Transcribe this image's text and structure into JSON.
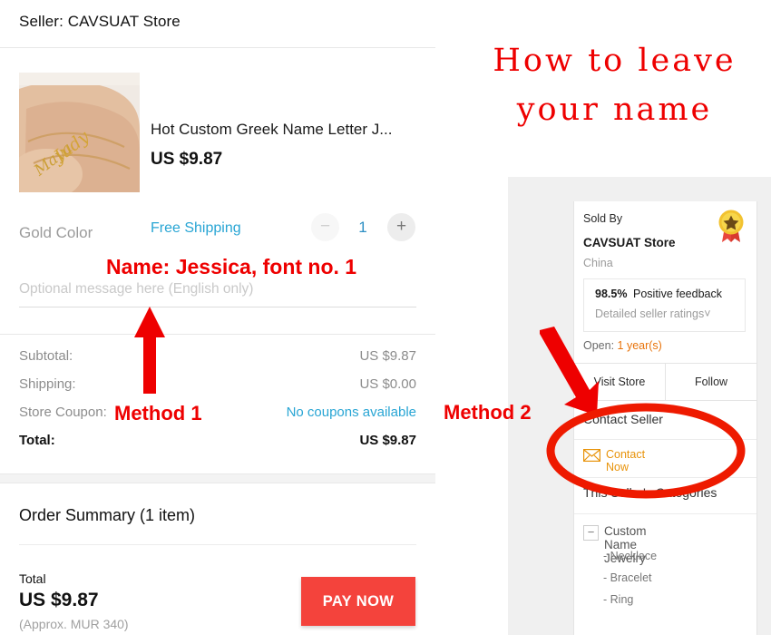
{
  "checkout": {
    "seller_header": "Seller: CAVSUAT Store",
    "product": {
      "title": "Hot Custom Greek Name Letter J...",
      "price": "US $9.87",
      "shipping_label": "Free Shipping",
      "quantity": "1",
      "minus_label": "−",
      "plus_label": "+",
      "image_alt": "gold-name-bracelet-on-wrist"
    },
    "attribute": "Gold Color",
    "message_placeholder": "Optional message here (English only)",
    "message_value": "",
    "totals": [
      {
        "label": "Subtotal:",
        "value": "US $9.87",
        "link": false
      },
      {
        "label": "Shipping:",
        "value": "US $0.00",
        "link": false
      },
      {
        "label": "Store Coupon:",
        "value": "No coupons available",
        "link": true
      }
    ],
    "total_row": {
      "label": "Total:",
      "value": "US $9.87"
    },
    "summary_title": "Order Summary (1 item)",
    "pay": {
      "total_label": "Total",
      "total_amount": "US $9.87",
      "approx": "(Approx. MUR 340)",
      "button": "PAY NOW"
    }
  },
  "right_panel": {
    "seller_card": {
      "sold_by": "Sold By",
      "store_name": "CAVSUAT Store",
      "country": "China",
      "badge_icon": "gold-medal-badge-icon",
      "feedback_percent": "98.5%",
      "feedback_label": "Positive feedback",
      "detailed_ratings": "Detailed seller ratings˅",
      "open_label": "Open: ",
      "open_value": "1 year(s)",
      "visit_store": "Visit Store",
      "follow": "Follow"
    },
    "contact_card": {
      "contact_seller": "Contact Seller",
      "contact_now": "Contact Now",
      "envelope_icon": "envelope-icon",
      "categories_title": "This Seller's Categories",
      "root_category": "Custom Name Jewelry",
      "collapse_glyph": "−",
      "subcategories": [
        "- Necklace",
        "- Bracelet",
        "- Ring"
      ]
    }
  },
  "annotations": {
    "title_line1": "How to leave",
    "title_line2": "your name",
    "name_hint": "Name: Jessica, font no. 1",
    "method1": "Method 1",
    "method2": "Method 2",
    "red": "#ee0000"
  }
}
